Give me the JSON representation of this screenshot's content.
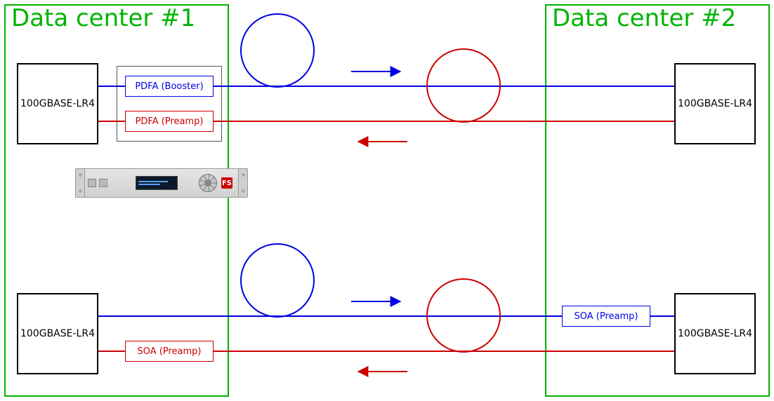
{
  "dc1": {
    "title": "Data center #1"
  },
  "dc2": {
    "title": "Data center #2"
  },
  "top": {
    "left_transceiver": "100GBASE-LR4",
    "right_transceiver": "100GBASE-LR4",
    "booster_label": "PDFA (Booster)",
    "preamp_label": "PDFA (Preamp)"
  },
  "bottom": {
    "left_transceiver": "100GBASE-LR4",
    "right_transceiver": "100GBASE-LR4",
    "left_preamp_label": "SOA (Preamp)",
    "right_preamp_label": "SOA (Preamp)"
  },
  "colors": {
    "blue": "#0000e6",
    "red": "#cc0000",
    "green": "#00b400"
  },
  "device": {
    "brand_short": "FS"
  }
}
